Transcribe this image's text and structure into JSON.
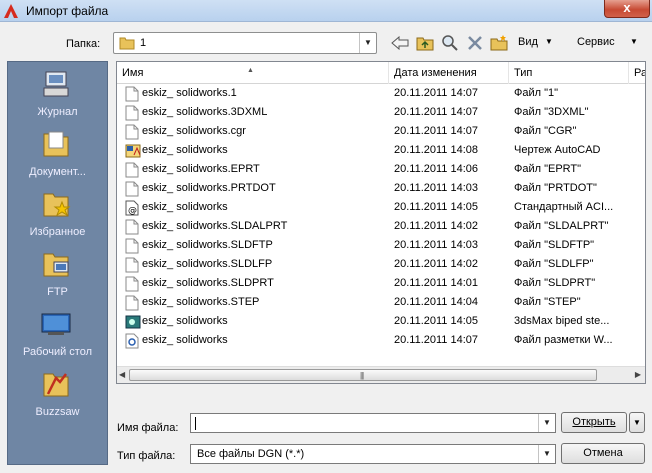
{
  "window": {
    "title": "Импорт файла",
    "close_label": "x"
  },
  "toolbar": {
    "look_in_label": "Папка:",
    "look_in_value": "1",
    "view_label": "Вид",
    "tools_label": "Сервис"
  },
  "places": [
    {
      "label": "Журнал",
      "icon": "history-icon"
    },
    {
      "label": "Документ...",
      "icon": "documents-folder-icon"
    },
    {
      "label": "Избранное",
      "icon": "favorites-icon"
    },
    {
      "label": "FTP",
      "icon": "ftp-icon"
    },
    {
      "label": "Рабочий стол",
      "icon": "desktop-icon"
    },
    {
      "label": "Buzzsaw",
      "icon": "buzzsaw-icon"
    }
  ],
  "filelist": {
    "columns": [
      "Имя",
      "Дата изменения",
      "Тип",
      "Ра"
    ],
    "rows": [
      {
        "name": "eskiz_ solidworks.1",
        "date": "20.11.2011 14:07",
        "type": "Файл \"1\"",
        "icon": "blank-file-icon"
      },
      {
        "name": "eskiz_ solidworks.3DXML",
        "date": "20.11.2011 14:07",
        "type": "Файл \"3DXML\"",
        "icon": "blank-file-icon"
      },
      {
        "name": "eskiz_ solidworks.cgr",
        "date": "20.11.2011 14:07",
        "type": "Файл \"CGR\"",
        "icon": "blank-file-icon"
      },
      {
        "name": "eskiz_ solidworks",
        "date": "20.11.2011 14:08",
        "type": "Чертеж AutoCAD",
        "icon": "autocad-drawing-icon"
      },
      {
        "name": "eskiz_ solidworks.EPRT",
        "date": "20.11.2011 14:06",
        "type": "Файл \"EPRT\"",
        "icon": "blank-file-icon"
      },
      {
        "name": "eskiz_ solidworks.PRTDOT",
        "date": "20.11.2011 14:03",
        "type": "Файл \"PRTDOT\"",
        "icon": "blank-file-icon"
      },
      {
        "name": "eskiz_ solidworks",
        "date": "20.11.2011 14:05",
        "type": "Стандартный ACI...",
        "icon": "acis-file-icon"
      },
      {
        "name": "eskiz_ solidworks.SLDALPRT",
        "date": "20.11.2011 14:02",
        "type": "Файл \"SLDALPRT\"",
        "icon": "blank-file-icon"
      },
      {
        "name": "eskiz_ solidworks.SLDFTP",
        "date": "20.11.2011 14:03",
        "type": "Файл \"SLDFTP\"",
        "icon": "blank-file-icon"
      },
      {
        "name": "eskiz_ solidworks.SLDLFP",
        "date": "20.11.2011 14:02",
        "type": "Файл \"SLDLFP\"",
        "icon": "blank-file-icon"
      },
      {
        "name": "eskiz_ solidworks.SLDPRT",
        "date": "20.11.2011 14:01",
        "type": "Файл \"SLDPRT\"",
        "icon": "blank-file-icon"
      },
      {
        "name": "eskiz_ solidworks.STEP",
        "date": "20.11.2011 14:04",
        "type": "Файл \"STEP\"",
        "icon": "blank-file-icon"
      },
      {
        "name": "eskiz_ solidworks",
        "date": "20.11.2011 14:05",
        "type": "3dsMax biped ste...",
        "icon": "3dsmax-file-icon"
      },
      {
        "name": "eskiz_ solidworks",
        "date": "20.11.2011 14:07",
        "type": "Файл разметки W...",
        "icon": "markup-file-icon"
      }
    ]
  },
  "bottom": {
    "filename_label": "Имя файла:",
    "filename_value": "",
    "filetype_label": "Тип файла:",
    "filetype_value": "Все файлы DGN (*.*)",
    "open_label": "Открыть",
    "cancel_label": "Отмена"
  }
}
